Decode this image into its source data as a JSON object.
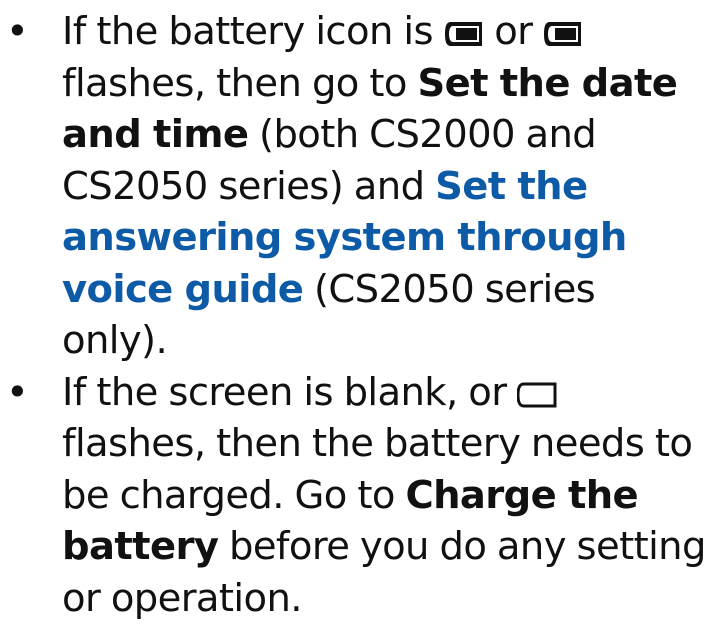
{
  "colors": {
    "text": "#111111",
    "link": "#0d5aa6",
    "background": "#ffffff"
  },
  "bullet_symbol": "•",
  "items": [
    {
      "t1": "If the battery icon is ",
      "icon1": "battery-full-icon",
      "t2": " or ",
      "icon2": "battery-full-icon",
      "t3": " flashes, then go to ",
      "bold1": "Set the date and time",
      "t4": " (both CS2000 and CS2050 series) and ",
      "link1": "Set the answering system through voice guide",
      "t5": " (CS2050 series only)."
    },
    {
      "t1": "If the screen is blank, or ",
      "icon1": "battery-empty-icon",
      "t2": " flashes, then the battery needs to be charged. Go to ",
      "bold1": "Charge the battery",
      "t3": " before you do any setting or operation."
    }
  ]
}
